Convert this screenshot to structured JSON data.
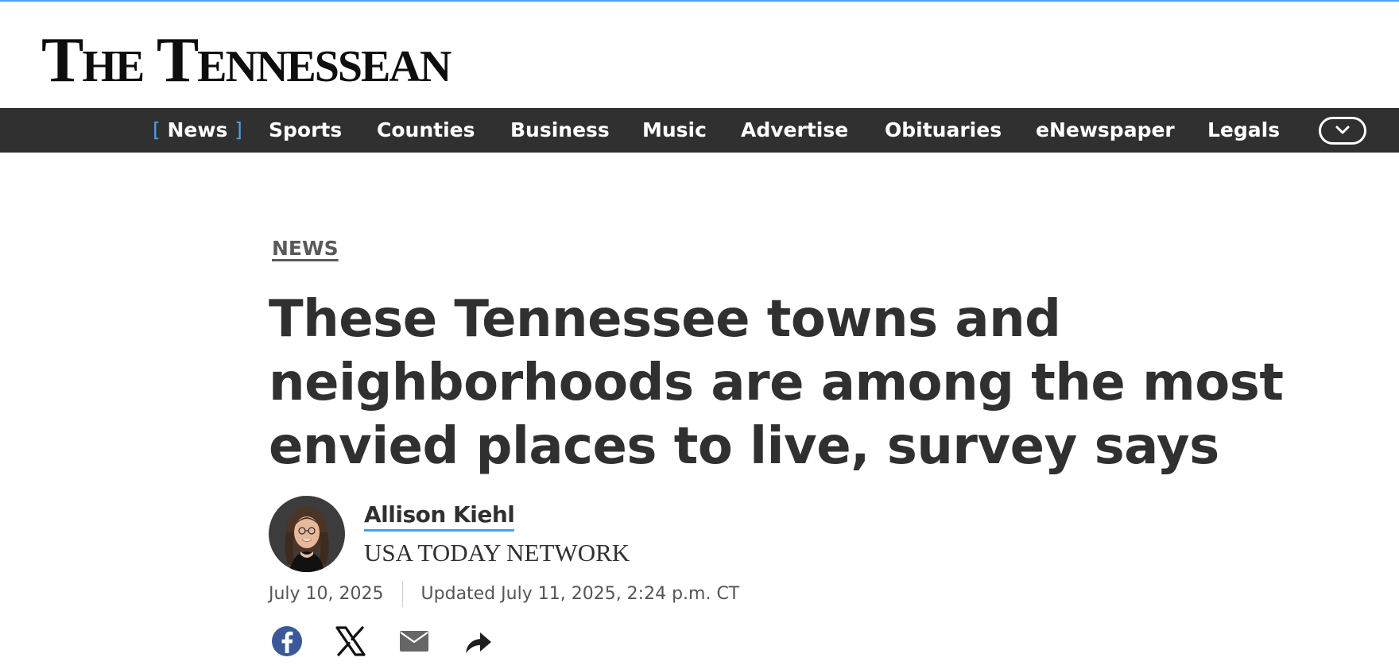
{
  "masthead": {
    "logo_text": "The Tennessean"
  },
  "nav": {
    "items": [
      {
        "label": "News",
        "active": true
      },
      {
        "label": "Sports"
      },
      {
        "label": "Counties"
      },
      {
        "label": "Business"
      },
      {
        "label": "Music"
      },
      {
        "label": "Advertise"
      },
      {
        "label": "Obituaries"
      },
      {
        "label": "eNewspaper"
      },
      {
        "label": "Legals"
      }
    ],
    "active_bracket_left": "[",
    "active_bracket_right": "]",
    "more_icon": "chevron-down-icon"
  },
  "article": {
    "category": "NEWS",
    "headline": "These Tennessee towns and neighborhoods are among the most envied places to live, survey says",
    "author": {
      "name": "Allison Kiehl",
      "organization": "USA TODAY NETWORK"
    },
    "published": "July 10, 2025",
    "updated": "Updated July 11, 2025, 2:24 p.m. CT"
  },
  "share": {
    "buttons": [
      "facebook-icon",
      "x-icon",
      "email-icon",
      "share-icon"
    ]
  },
  "colors": {
    "accent": "#4a9ff0",
    "nav_bg": "#303030",
    "facebook": "#3b5998",
    "text": "#303030"
  }
}
